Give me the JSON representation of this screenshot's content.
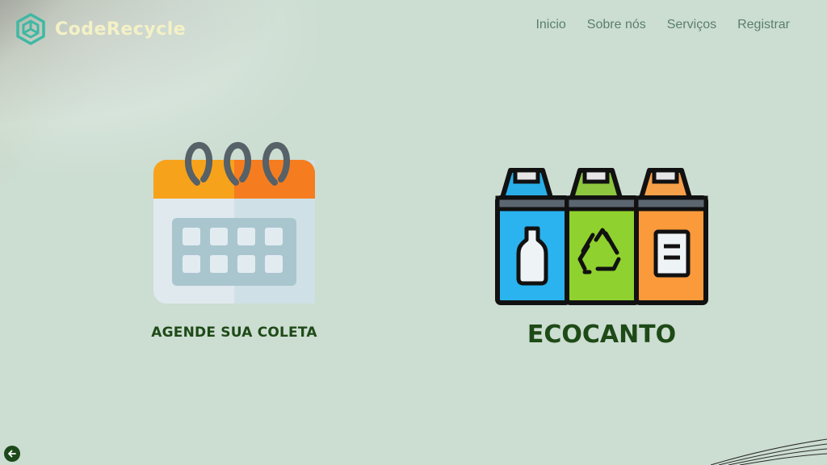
{
  "brand": {
    "name": "CodeRecycle",
    "logo_icon": "hexagon-logo-icon",
    "logo_color": "#3fb8a3"
  },
  "nav": {
    "items": [
      "Inicio",
      "Sobre nós",
      "Serviços",
      "Registrar"
    ]
  },
  "cards": {
    "schedule": {
      "label": "AGENDE SUA COLETA",
      "icon": "calendar-icon"
    },
    "ecocanto": {
      "label": "ECOCANTO",
      "icon": "recycling-bins-icon"
    }
  },
  "footer": {
    "back_icon": "arrow-left-icon"
  },
  "colors": {
    "background": "#ccddd1",
    "label_text": "#1e4a17",
    "nav_text": "#5b7f6b",
    "brand_text": "#f4f1c6"
  }
}
